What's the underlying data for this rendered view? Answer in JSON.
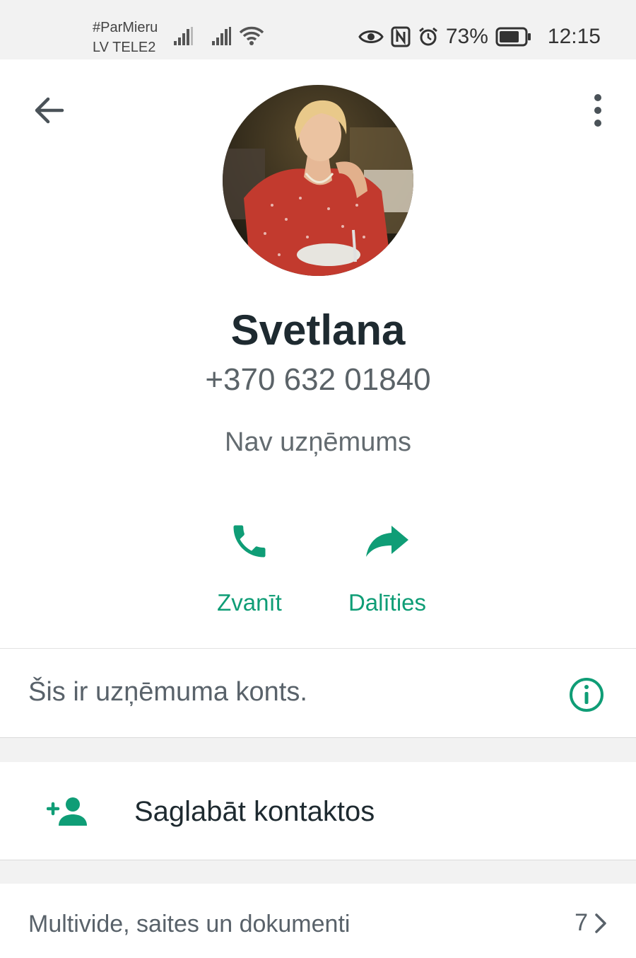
{
  "status_bar": {
    "carrier_line1": "#ParMieru",
    "carrier_line2": "LV TELE2",
    "battery": "73%",
    "time": "12:15",
    "icons": [
      "signal-icon",
      "signal-icon",
      "wifi-icon",
      "eye-icon",
      "nfc-icon",
      "alarm-icon",
      "battery-icon"
    ]
  },
  "header": {
    "back_icon": "arrow-left-icon",
    "menu_icon": "more-vert-icon"
  },
  "contact": {
    "name": "Svetlana",
    "phone": "+370 632 01840",
    "business_name": "Nav uzņēmums"
  },
  "actions": [
    {
      "label": "Zvanīt",
      "icon": "phone-icon"
    },
    {
      "label": "Dalīties",
      "icon": "share-icon"
    }
  ],
  "business_notice": {
    "text": "Šis ir uzņēmuma konts.",
    "icon": "info-icon"
  },
  "save_contact": {
    "label": "Saglabāt kontaktos",
    "icon": "person-add-icon"
  },
  "media": {
    "label": "Multivide, saites un dokumenti",
    "count": "7",
    "icon": "chevron-right-icon"
  },
  "colors": {
    "accent": "#0f9d76",
    "text_primary": "#1e2a30",
    "text_secondary": "#5b6368",
    "status_bg": "#f2f2f2"
  }
}
